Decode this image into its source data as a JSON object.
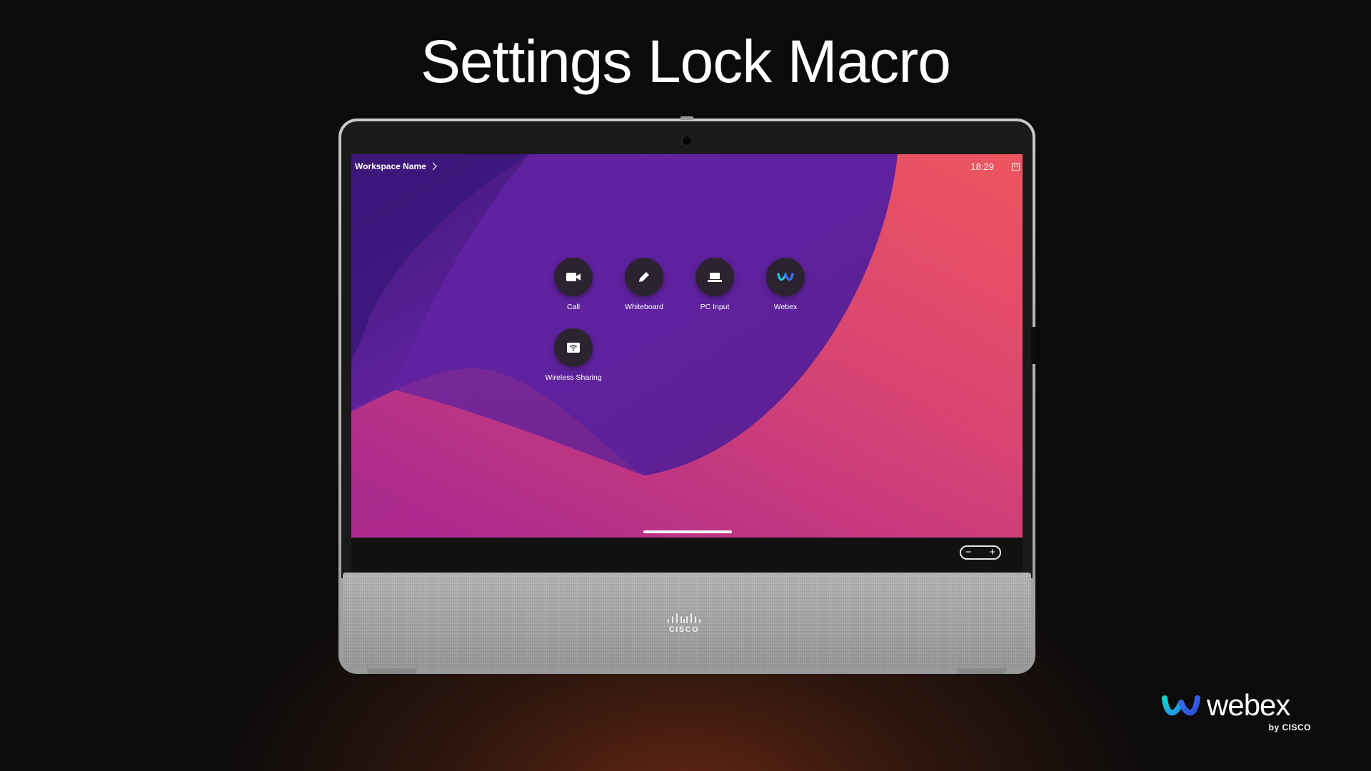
{
  "page": {
    "title": "Settings Lock Macro"
  },
  "device": {
    "screen": {
      "workspace_name": "Workspace Name",
      "clock": "18:29",
      "apps": [
        {
          "label": "Call",
          "icon": "video-camera-icon"
        },
        {
          "label": "Whiteboard",
          "icon": "pencil-icon"
        },
        {
          "label": "PC Input",
          "icon": "laptop-icon"
        },
        {
          "label": "Webex",
          "icon": "webex-logo-icon"
        },
        {
          "label": "Wireless Sharing",
          "icon": "wireless-share-icon"
        }
      ]
    },
    "volume": {
      "minus": "−",
      "plus": "+"
    },
    "speaker_logo_text": "CISCO"
  },
  "brand": {
    "name": "webex",
    "byline": "by CISCO"
  },
  "colors": {
    "background": "#0b0b0b",
    "screen_purple": "#5a1f99",
    "screen_coral": "#f0585e",
    "app_disc": "#2b2430"
  }
}
